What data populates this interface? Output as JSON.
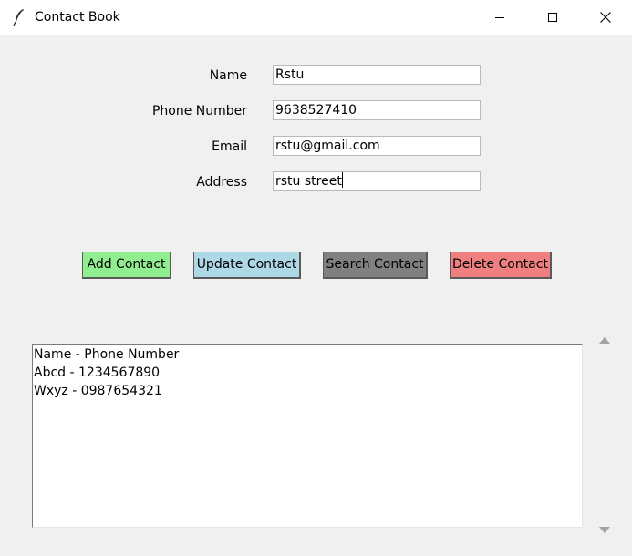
{
  "window": {
    "title": "Contact Book",
    "icon": "feather-icon",
    "controls": [
      "minimize-icon",
      "maximize-icon",
      "close-icon"
    ]
  },
  "form": {
    "name": {
      "label": "Name",
      "value": "Rstu"
    },
    "phone": {
      "label": "Phone Number",
      "value": "9638527410"
    },
    "email": {
      "label": "Email",
      "value": "rstu@gmail.com"
    },
    "address": {
      "label": "Address",
      "value": "rstu street"
    }
  },
  "buttons": {
    "add": {
      "label": "Add Contact",
      "color": "#90ee90"
    },
    "update": {
      "label": "Update Contact",
      "color": "#add8e6"
    },
    "search": {
      "label": "Search Contact",
      "color": "#808080"
    },
    "delete": {
      "label": "Delete Contact",
      "color": "#f08080"
    }
  },
  "list": {
    "items": [
      "Name - Phone Number",
      "Abcd - 1234567890",
      "Wxyz - 0987654321"
    ]
  }
}
